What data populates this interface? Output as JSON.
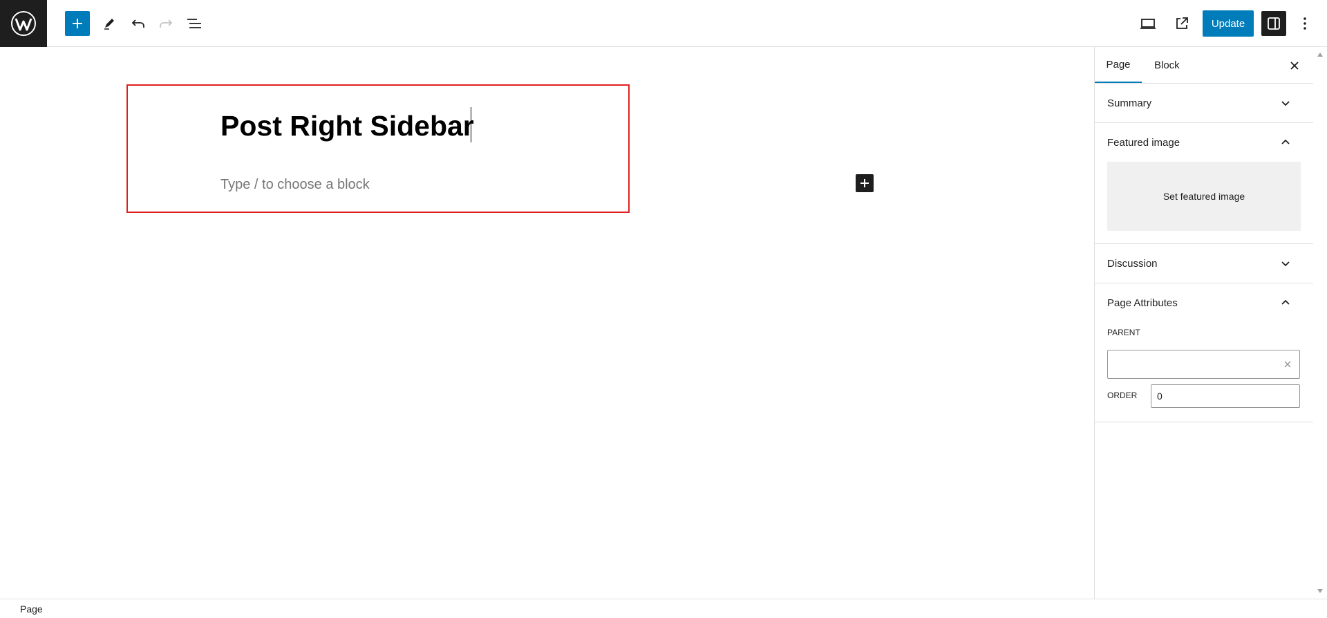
{
  "toolbar": {
    "logo_icon": "wordpress-icon",
    "add_block_icon": "plus-icon",
    "tools_icon": "pencil-icon",
    "undo_icon": "undo-icon",
    "redo_icon": "redo-icon",
    "list_view_icon": "list-view-icon",
    "preview_icon": "desktop-icon",
    "view_page_icon": "external-icon",
    "update_label": "Update",
    "settings_icon": "sidebar-icon",
    "options_icon": "more-vertical-icon",
    "accent_color": "#007cba"
  },
  "editor": {
    "title": "Post Right Sidebar",
    "placeholder": "Type / to choose a block",
    "highlight_color": "#e0201f"
  },
  "sidebar": {
    "tabs": [
      {
        "label": "Page",
        "active": true
      },
      {
        "label": "Block",
        "active": false
      }
    ],
    "panels": {
      "summary": {
        "title": "Summary",
        "expanded": false
      },
      "featured_image": {
        "title": "Featured image",
        "expanded": true,
        "button_label": "Set featured image"
      },
      "discussion": {
        "title": "Discussion",
        "expanded": false
      },
      "page_attributes": {
        "title": "Page Attributes",
        "expanded": true,
        "parent_label": "PARENT",
        "parent_value": "",
        "order_label": "ORDER",
        "order_value": "0"
      }
    }
  },
  "footer": {
    "breadcrumb": "Page"
  }
}
